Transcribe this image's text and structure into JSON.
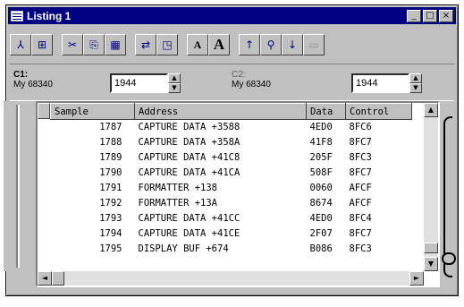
{
  "window": {
    "title": "Listing 1"
  },
  "title_buttons": [
    "_",
    "□",
    "×"
  ],
  "toolbar": {
    "icons": [
      "tree-split-icon",
      "insert-icon",
      "cut-icon",
      "copy-icon",
      "paste-icon",
      "find-replace-icon",
      "new-window-icon",
      "font-smaller-icon",
      "font-larger-icon",
      "arrow-up-icon",
      "binoculars-icon",
      "arrow-down-icon",
      "disabled-tool-icon"
    ],
    "glyphs": [
      "⅄",
      "⊞",
      "✂",
      "⎘",
      "▦",
      "⇄",
      "◳",
      "A",
      "A",
      "↑",
      "⚲",
      "↓",
      "▭"
    ]
  },
  "cursors": {
    "c1": {
      "name": "C1:",
      "source": "My 68340",
      "value": "1944"
    },
    "c2": {
      "name": "C2:",
      "source": "My 68340",
      "value": "1944"
    }
  },
  "table": {
    "headers": [
      "Sample",
      "Address",
      "Data",
      "Control"
    ],
    "rows": [
      {
        "sample": "1787",
        "address": "CAPTURE DATA +3588",
        "data": "4ED0",
        "control": "8FC6"
      },
      {
        "sample": "1788",
        "address": "CAPTURE DATA +358A",
        "data": "41F8",
        "control": "8FC7"
      },
      {
        "sample": "1789",
        "address": "CAPTURE DATA +41C8",
        "data": "205F",
        "control": "8FC3"
      },
      {
        "sample": "1790",
        "address": "CAPTURE DATA +41CA",
        "data": "508F",
        "control": "8FC7"
      },
      {
        "sample": "1791",
        "address": "FORMATTER +138",
        "data": "0060",
        "control": "AFCF"
      },
      {
        "sample": "1792",
        "address": "FORMATTER +13A",
        "data": "8674",
        "control": "AFCF"
      },
      {
        "sample": "1793",
        "address": "CAPTURE DATA +41CC",
        "data": "4ED0",
        "control": "8FC4"
      },
      {
        "sample": "1794",
        "address": "CAPTURE DATA +41CE",
        "data": "2F07",
        "control": "8FC7"
      },
      {
        "sample": "1795",
        "address": "DISPLAY BUF +674",
        "data": "B086",
        "control": "8FC3"
      }
    ]
  },
  "scroll": {
    "up": "▲",
    "down": "▼",
    "left": "◄",
    "right": "►"
  }
}
